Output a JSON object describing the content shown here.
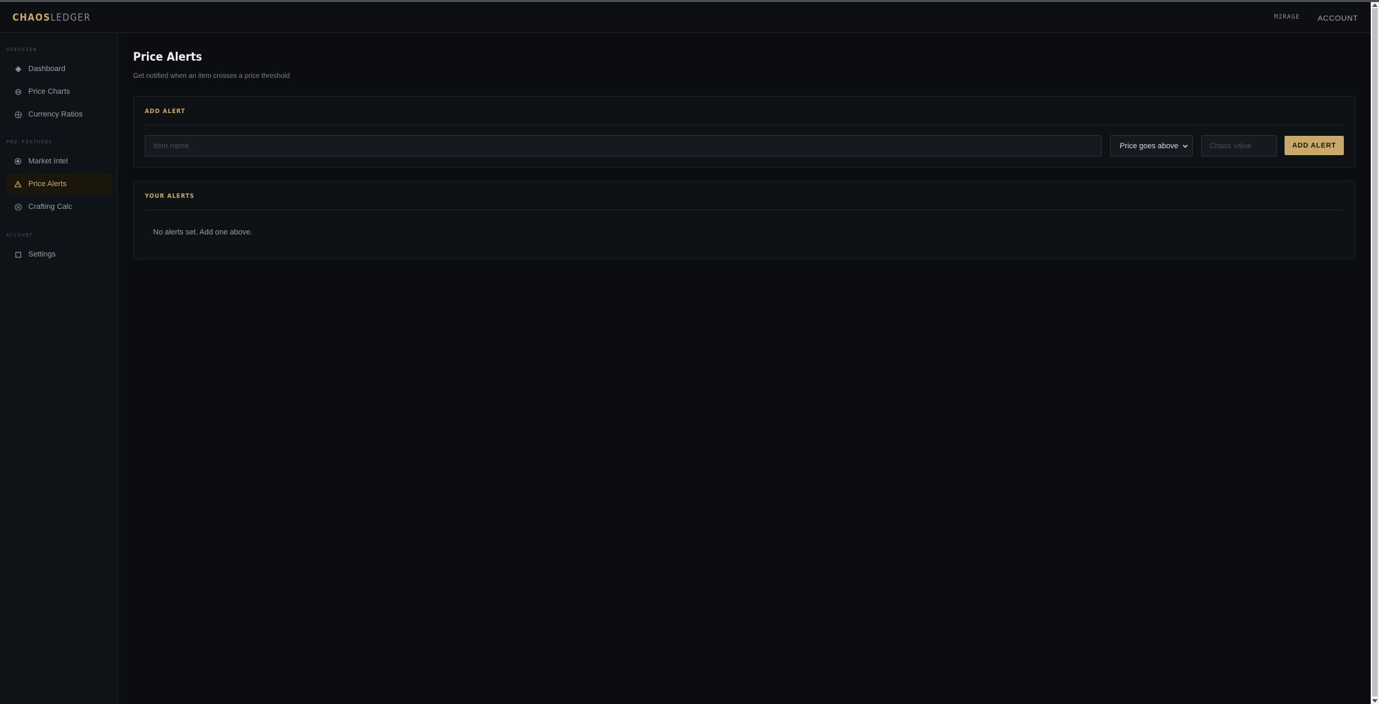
{
  "brand": {
    "part1": "CHAOS",
    "part2": "LEDGER"
  },
  "header": {
    "league": "MIRAGE",
    "account": "ACCOUNT"
  },
  "sidebar": {
    "sections": [
      {
        "title": "OVERVIEW"
      },
      {
        "title": "PRO FEATURES"
      },
      {
        "title": "ACCOUNT"
      }
    ],
    "items": [
      {
        "label": "Dashboard",
        "icon": "diamond-icon",
        "active": false
      },
      {
        "label": "Price Charts",
        "icon": "chart-icon",
        "active": false
      },
      {
        "label": "Currency Ratios",
        "icon": "globe-icon",
        "active": false
      },
      {
        "label": "Market Intel",
        "icon": "target-icon",
        "active": false
      },
      {
        "label": "Price Alerts",
        "icon": "warning-icon",
        "active": true
      },
      {
        "label": "Crafting Calc",
        "icon": "cross-circle-icon",
        "active": false
      },
      {
        "label": "Settings",
        "icon": "square-icon",
        "active": false
      }
    ]
  },
  "page": {
    "title": "Price Alerts",
    "subtitle": "Get notified when an item crosses a price threshold"
  },
  "add_alert": {
    "title": "ADD ALERT",
    "item_placeholder": "Item name",
    "condition_selected": "Price goes above",
    "value_placeholder": "Chaos value",
    "button_label": "ADD ALERT"
  },
  "your_alerts": {
    "title": "YOUR ALERTS",
    "empty_text": "No alerts set. Add one above."
  },
  "colors": {
    "accent": "#c9a86a",
    "background": "#0b0d10",
    "sidebar": "#0f1216",
    "active_item_bg": "#1a160c"
  }
}
